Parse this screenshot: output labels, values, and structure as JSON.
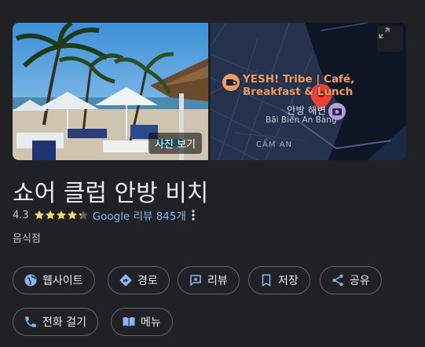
{
  "place": {
    "name": "쇼어 클럽 안방 비치",
    "rating": "4.3",
    "stars": 4.3,
    "reviews": "Google 리뷰 845개",
    "category": "음식점"
  },
  "hero": {
    "photo_button": "사진 보기"
  },
  "map": {
    "poi_line1": "YESH! Tribe | Café,",
    "poi_line2": "Breakfast & Lunch",
    "beach_name": "안방 해변",
    "beach_name_vi": "Bãi Biển An Bàng",
    "street": "CẨM AN"
  },
  "actions": [
    {
      "label": "웹사이트",
      "icon": "globe-icon"
    },
    {
      "label": "경로",
      "icon": "directions-icon"
    },
    {
      "label": "리뷰",
      "icon": "review-icon"
    },
    {
      "label": "저장",
      "icon": "bookmark-icon"
    },
    {
      "label": "공유",
      "icon": "share-icon"
    },
    {
      "label": "전화 걸기",
      "icon": "phone-icon"
    },
    {
      "label": "메뉴",
      "icon": "menu-book-icon"
    }
  ],
  "colors": {
    "background": "#202124",
    "accent_blue": "#8ab4f8",
    "star_yellow": "#fdd663",
    "map_pin_red": "#ea4335",
    "poi_orange": "#f29a5e",
    "camera_purple": "#b99ce0"
  }
}
